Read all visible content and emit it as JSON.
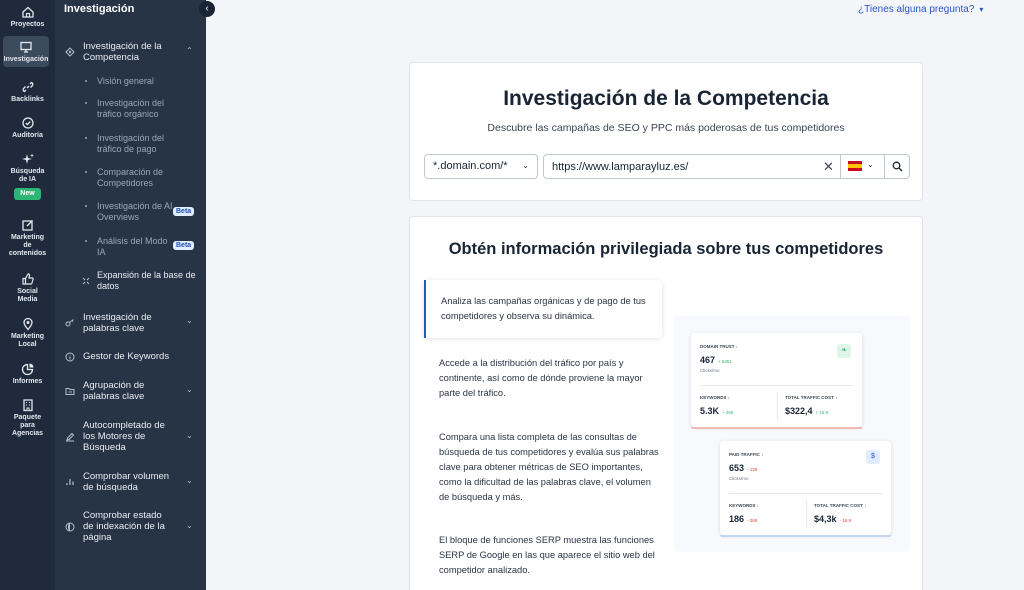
{
  "rail": {
    "items": [
      {
        "label": "Proyectos",
        "icon": "home-icon"
      },
      {
        "label": "Investigación",
        "icon": "monitor-icon"
      },
      {
        "label": "Backlinks",
        "icon": "link-icon"
      },
      {
        "label": "Auditoría",
        "icon": "check-circle-icon"
      },
      {
        "label": "Búsqueda de IA",
        "icon": "sparkle-icon",
        "badge": "New"
      },
      {
        "label": "Marketing de contenidos",
        "icon": "edit-icon"
      },
      {
        "label": "Social Media",
        "icon": "thumbs-up-icon"
      },
      {
        "label": "Marketing Local",
        "icon": "location-pin-icon"
      },
      {
        "label": "Informes",
        "icon": "chart-pie-icon"
      },
      {
        "label": "Paquete para Agencias",
        "icon": "building-icon"
      }
    ]
  },
  "submenu": {
    "title": "Investigación",
    "sections": [
      {
        "label": "Investigación de la Competencia",
        "icon": "target-icon"
      },
      {
        "label": "Expansión de la base de datos",
        "icon": "expand-icon"
      },
      {
        "label": "Investigación de palabras clave",
        "icon": "key-icon"
      },
      {
        "label": "Gestor de Keywords",
        "icon": "circle-info-icon"
      },
      {
        "label": "Agrupación de palabras clave",
        "icon": "folder-icon"
      },
      {
        "label": "Autocompletado de los Motores de Búsqueda",
        "icon": "pencil-icon"
      },
      {
        "label": "Comprobar volumen de búsqueda",
        "icon": "bars-icon"
      },
      {
        "label": "Comprobar estado de indexación de la página",
        "icon": "globe-icon"
      }
    ],
    "subitems": [
      {
        "label": "Visión general"
      },
      {
        "label": "Investigación del tráfico orgánico"
      },
      {
        "label": "Investigación del tráfico de pago"
      },
      {
        "label": "Comparación de Competidores"
      },
      {
        "label": "Investigación de AI Overviews",
        "badge": "Beta"
      },
      {
        "label": "Análisis del Modo IA",
        "badge": "Beta"
      }
    ]
  },
  "header": {
    "help": "¿Tienes alguna pregunta?"
  },
  "search_card": {
    "title": "Investigación de la Competencia",
    "subtitle": "Descubre las campañas de SEO y PPC más poderosas de tus competidores",
    "scope_value": "*.domain.com/*",
    "url_value": "https://www.lamparayluz.es/",
    "country_flag": "spain-flag"
  },
  "info_card": {
    "title": "Obtén información privilegiada sobre tus competidores",
    "features": [
      "Analiza las campañas orgánicas y de pago de tus competidores y observa su dinámica.",
      "Accede a la distribución del tráfico por país y continente, así como de dónde proviene la mayor parte del tráfico.",
      "Compara una lista completa de las consultas de búsqueda de tus competidores y evalúa sus palabras clave para obtener métricas de SEO importantes, como la dificultad de las palabras clave, el volumen de búsqueda y más.",
      "El bloque de funciones SERP muestra las funciones SERP de Google en las que aparece el sitio web del competidor analizado."
    ],
    "preview": {
      "card_a": {
        "domain_trust_label": "DOMAIN TRUST ↓",
        "domain_trust_value": "467",
        "domain_trust_delta": "+ 6351",
        "clicks_label": "Clicks/mo",
        "keywords_label": "KEYWORDS ↓",
        "keywords_value": "5.3K",
        "keywords_delta": "+ 265",
        "cost_label": "TOTAL TRAFFIC COST ↓",
        "cost_value": "$322,4",
        "cost_delta": "+ 16.9"
      },
      "card_b": {
        "paid_label": "PAID TRAFFIC ↓",
        "paid_value": "653",
        "paid_delta": "- 128",
        "clicks_label": "Clicks/mo",
        "badge": "$",
        "keywords_label": "KEYWORDS ↓",
        "keywords_value": "186",
        "keywords_delta": "- 265",
        "cost_label": "TOTAL TRAFFIC COST ↓",
        "cost_value": "$4,3k",
        "cost_delta": "- 16.9"
      }
    }
  },
  "colors": {
    "rail_bg": "#1f2b3c",
    "submenu_bg": "#263446",
    "accent": "#2756c5",
    "new_badge": "#2bb673",
    "beta_badge": "#e0ecff"
  }
}
